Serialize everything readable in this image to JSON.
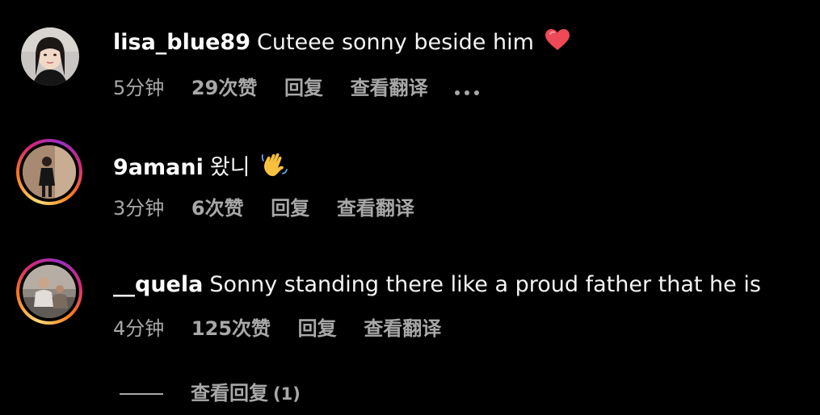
{
  "comments": [
    {
      "username": "lisa_blue89",
      "text": "Cuteee sonny beside him",
      "emoji": "heart-icon",
      "time": "5分钟",
      "likes": "29次赞",
      "reply": "回复",
      "translate": "查看翻译",
      "has_story_ring": false
    },
    {
      "username": "9amani",
      "text": "왔니",
      "emoji": "waving-hand-icon",
      "time": "3分钟",
      "likes": "6次赞",
      "reply": "回复",
      "translate": "查看翻译",
      "has_story_ring": true
    },
    {
      "username": "__quela",
      "text": "Sonny standing there like a proud father that he is",
      "time": "4分钟",
      "likes": "125次赞",
      "reply": "回复",
      "translate": "查看翻译",
      "has_story_ring": true
    }
  ],
  "view_replies": {
    "label": "查看回复",
    "count": "(1)"
  },
  "colors": {
    "background": "#000000",
    "text_primary": "#f5f5f5",
    "text_secondary": "#a8a8a8",
    "heart": "#ed4956"
  }
}
